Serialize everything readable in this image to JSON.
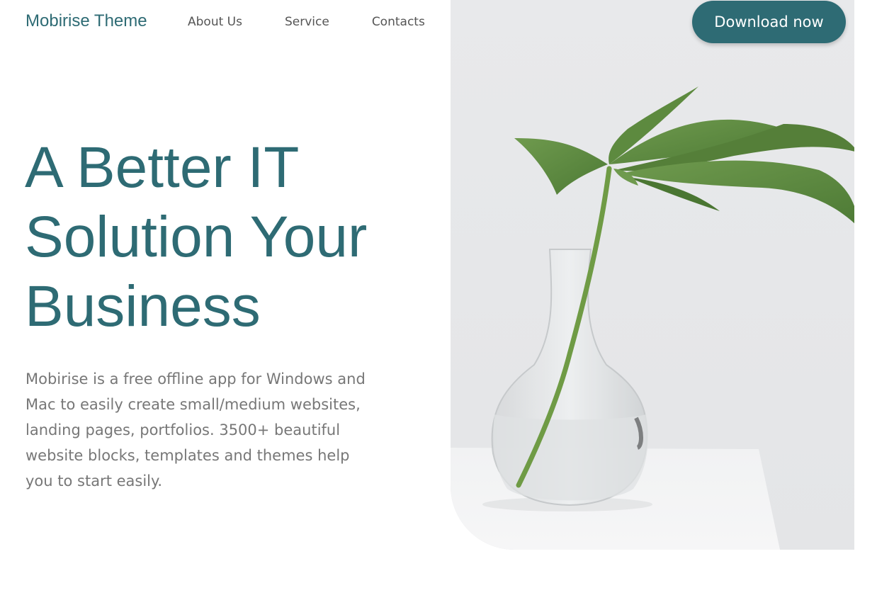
{
  "navbar": {
    "brand": "Mobirise Theme",
    "links": [
      "About Us",
      "Service",
      "Contacts"
    ],
    "cta_label": "Download now"
  },
  "hero": {
    "title": "A Better IT Solution Your Business",
    "description": "Mobirise is a free offline app for Windows and Mac to easily create small/medium websites, landing pages, portfolios. 3500+ beautiful website blocks, templates and themes help you to start easily."
  },
  "colors": {
    "primary": "#2e6b74",
    "nav_text": "#555555",
    "body_text": "#777777",
    "image_bg": "#e9eaec"
  }
}
